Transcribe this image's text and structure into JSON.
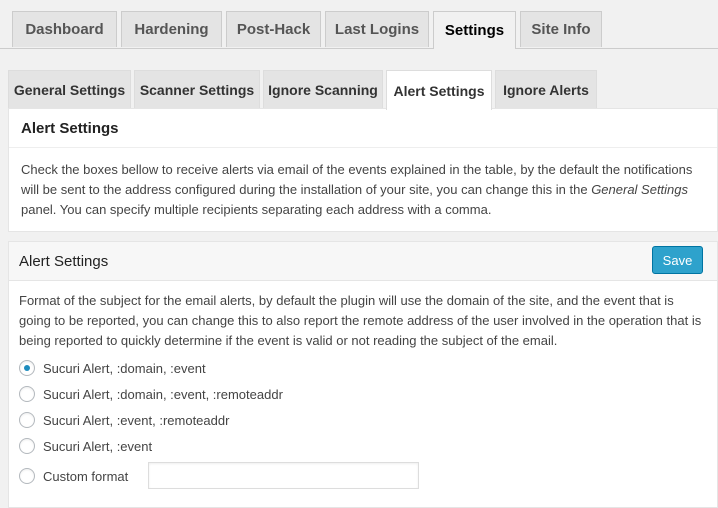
{
  "top_tabs": [
    {
      "label": "Dashboard"
    },
    {
      "label": "Hardening"
    },
    {
      "label": "Post-Hack"
    },
    {
      "label": "Last Logins"
    },
    {
      "label": "Settings",
      "active": true
    },
    {
      "label": "Site Info"
    }
  ],
  "sub_tabs": [
    {
      "label": "General Settings"
    },
    {
      "label": "Scanner Settings"
    },
    {
      "label": "Ignore Scanning"
    },
    {
      "label": "Alert Settings",
      "active": true
    },
    {
      "label": "Ignore Alerts"
    }
  ],
  "intro_box": {
    "title": "Alert Settings",
    "text_before": "Check the boxes bellow to receive alerts via email of the events explained in the table, by the default the notifications will be sent to the address configured during the installation of your site, you can change this in the ",
    "text_emphasis": "General Settings",
    "text_after": " panel. You can specify multiple recipients separating each address with a comma."
  },
  "subject_box": {
    "title": "Alert Settings",
    "save_label": "Save",
    "description": "Format of the subject for the email alerts, by default the plugin will use the domain of the site, and the event that is going to be reported, you can change this to also report the remote address of the user involved in the operation that is being reported to quickly determine if the event is valid or not reading the subject of the email.",
    "options": [
      {
        "label": "Sucuri Alert, :domain, :event",
        "selected": true
      },
      {
        "label": "Sucuri Alert, :domain, :event, :remoteaddr",
        "selected": false
      },
      {
        "label": "Sucuri Alert, :event, :remoteaddr",
        "selected": false
      },
      {
        "label": "Sucuri Alert, :event",
        "selected": false
      },
      {
        "label": "Custom format",
        "selected": false
      }
    ],
    "custom_format_value": ""
  },
  "colors": {
    "accent": "#2ea2cc",
    "radio_dot": "#1e8cbe"
  }
}
